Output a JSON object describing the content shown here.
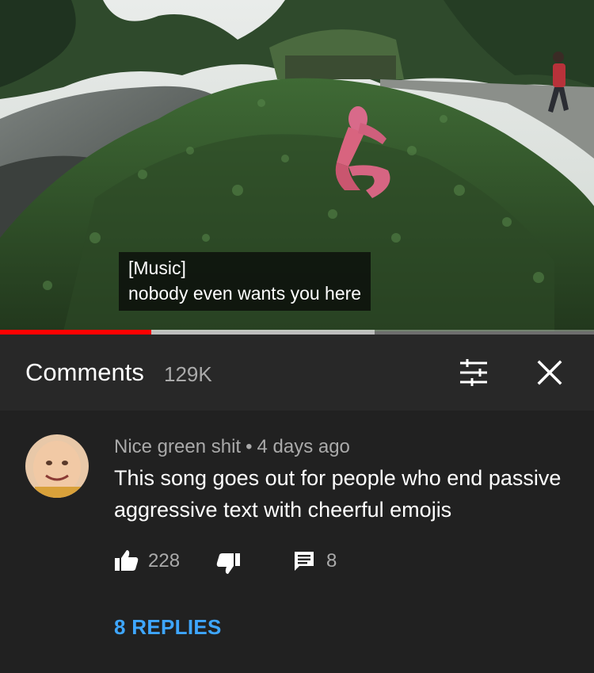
{
  "video": {
    "caption_lines": [
      "[Music]",
      "nobody even wants you here"
    ],
    "progress_played": 0.255,
    "progress_buffered": 0.63
  },
  "comments_panel": {
    "title": "Comments",
    "count": "129K",
    "filter_icon": "sort-filter-icon",
    "close_icon": "close-icon"
  },
  "comment": {
    "author": "Nice green shit",
    "separator": "•",
    "time": "4 days ago",
    "text": "This song goes out for people who end passive aggressive text with cheerful emojis",
    "likes": "228",
    "replies_count": "8",
    "view_replies_label": "8 REPLIES",
    "icons": [
      "thumbs-up-icon",
      "thumbs-down-icon",
      "comment-reply-icon"
    ]
  },
  "colors": {
    "panel_bg": "#212121",
    "header_bg": "#282828",
    "link_blue": "#3ea6ff",
    "progress_red": "#ff0000",
    "secondary_text": "#aaaaaa"
  }
}
